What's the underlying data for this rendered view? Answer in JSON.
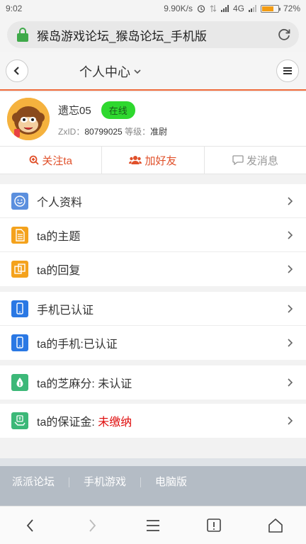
{
  "status_bar": {
    "time": "9:02",
    "speed": "9.90K/s",
    "network": "4G",
    "battery": "72%",
    "battery_level": 0.72
  },
  "browser": {
    "url_title": "猴岛游戏论坛_猴岛论坛_手机版"
  },
  "header": {
    "title": "个人中心"
  },
  "profile": {
    "username": "遗忘05",
    "status": "在线",
    "id_label": "ZxID：",
    "id_value": "80799025",
    "level_label": "等级：",
    "level_value": "准尉"
  },
  "actions": {
    "follow": "关注ta",
    "add_friend": "加好友",
    "message": "发消息"
  },
  "menu": {
    "group1": [
      "个人资料",
      "ta的主题",
      "ta的回复"
    ],
    "group2": [
      "手机已认证",
      "ta的手机:已认证"
    ],
    "group3": [
      "ta的芝麻分: 未认证"
    ],
    "group4": {
      "prefix": "ta的保证金: ",
      "status": "未缴纳"
    }
  },
  "footer": {
    "links": [
      "派派论坛",
      "手机游戏",
      "电脑版"
    ]
  },
  "colors": {
    "accent": "#ef6a3a",
    "online": "#2ed82e",
    "warning": "#e01010"
  }
}
